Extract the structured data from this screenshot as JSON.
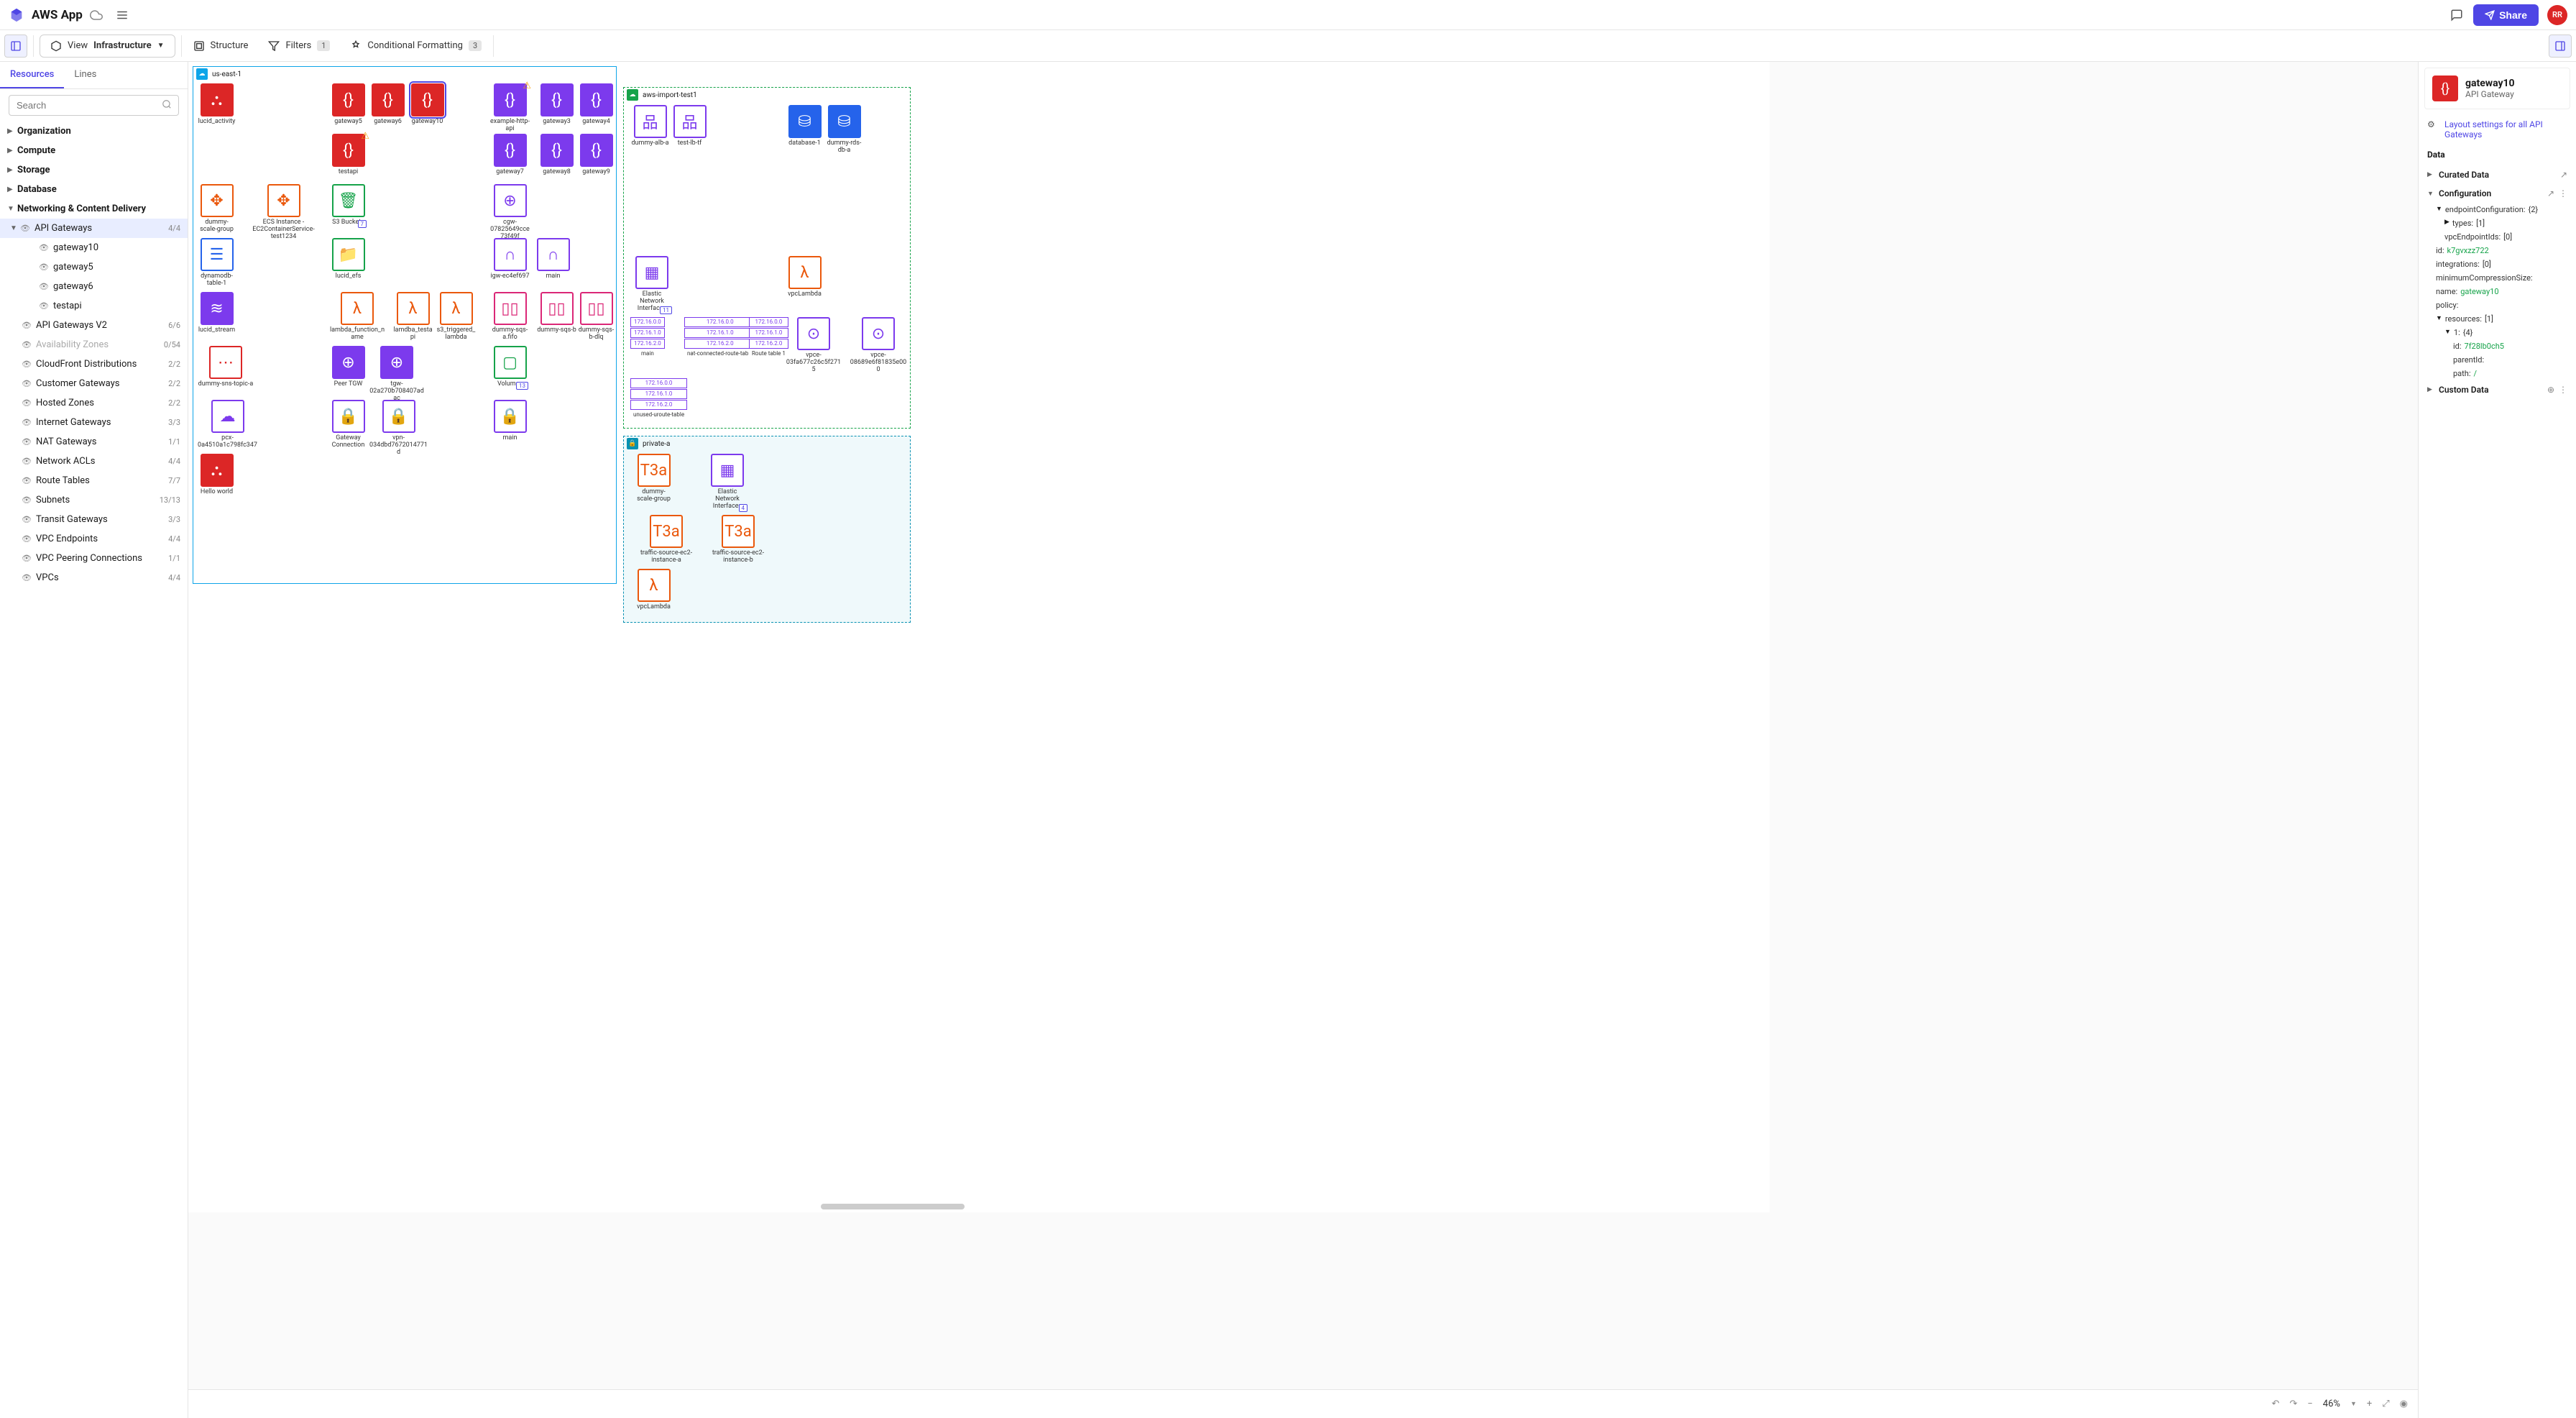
{
  "app": {
    "title": "AWS App",
    "avatar": "RR",
    "share_label": "Share"
  },
  "toolbar": {
    "view_label": "View",
    "view_value": "Infrastructure",
    "structure_label": "Structure",
    "filters_label": "Filters",
    "filters_count": "1",
    "cond_fmt_label": "Conditional Formatting",
    "cond_fmt_count": "3"
  },
  "tabs": {
    "resources": "Resources",
    "lines": "Lines"
  },
  "search": {
    "placeholder": "Search"
  },
  "tree": {
    "organization": "Organization",
    "compute": "Compute",
    "storage": "Storage",
    "database": "Database",
    "networking": "Networking & Content Delivery",
    "api_gateways": {
      "label": "API Gateways",
      "count": "4/4"
    },
    "items_api": [
      "gateway10",
      "gateway5",
      "gateway6",
      "testapi"
    ],
    "rest": [
      {
        "label": "API Gateways V2",
        "count": "6/6"
      },
      {
        "label": "Availability Zones",
        "count": "0/54",
        "dim": true
      },
      {
        "label": "CloudFront Distributions",
        "count": "2/2"
      },
      {
        "label": "Customer Gateways",
        "count": "2/2"
      },
      {
        "label": "Hosted Zones",
        "count": "2/2"
      },
      {
        "label": "Internet Gateways",
        "count": "3/3"
      },
      {
        "label": "NAT Gateways",
        "count": "1/1"
      },
      {
        "label": "Network ACLs",
        "count": "4/4"
      },
      {
        "label": "Route Tables",
        "count": "7/7"
      },
      {
        "label": "Subnets",
        "count": "13/13"
      },
      {
        "label": "Transit Gateways",
        "count": "3/3"
      },
      {
        "label": "VPC Endpoints",
        "count": "4/4"
      },
      {
        "label": "VPC Peering Connections",
        "count": "1/1"
      },
      {
        "label": "VPCs",
        "count": "4/4"
      }
    ]
  },
  "regions": {
    "useast": "us-east-1",
    "awsimport": "aws-import-test1",
    "privatea": "private-a"
  },
  "resources": {
    "lucid_activity": "lucid_activity",
    "gateway5": "gateway5",
    "gateway6": "gateway6",
    "gateway10": "gateway10",
    "testapi": "testapi",
    "example_http": "example-http-api",
    "gateway3": "gateway3",
    "gateway4": "gateway4",
    "gateway7": "gateway7",
    "gateway8": "gateway8",
    "gateway9": "gateway9",
    "dummy_scale": "dummy-scale-group",
    "ecs_instance": "ECS Instance - EC2ContainerService-test1234",
    "s3_buckets": "S3 Buckets",
    "s3_count": "7",
    "dynamodb": "dynamodb-table-1",
    "lucid_efs": "lucid_efs",
    "cgw": "cgw-07825649cce73f49f",
    "igw": "igw-ec4ef697",
    "main": "main",
    "lucid_stream": "lucid_stream",
    "lambda_fn": "lambda_function_name",
    "lambda_test": "lamdba_testapi",
    "s3_trig": "s3_triggered_lambda",
    "sqs_afifo": "dummy-sqs-a.fifo",
    "sqs_b": "dummy-sqs-b",
    "sqs_bdlq": "dummy-sqs-b-dlq",
    "sns_topic": "dummy-sns-topic-a",
    "peer_tgw": "Peer TGW",
    "tgw": "tgw-02a270b708407adac",
    "volumes": "Volumes",
    "vol_count": "13",
    "pcx": "pcx-0a4510a1c798fc347",
    "gw_conn": "Gateway Connection",
    "vpn": "vpn-034dbd7672014771d",
    "main2": "main",
    "hello": "Hello world",
    "dummy_alb": "dummy-alb-a",
    "test_lb": "test-lb-tf",
    "database1": "database-1",
    "dummy_rds": "dummy-rds-db-a",
    "eni": "Elastic Network Interfaces",
    "eni_count": "11",
    "vpclambda": "vpcLambda",
    "rt_main": "main",
    "rt_nat": "nat-connected-route-table",
    "rt_1": "Route table 1",
    "vpce1": "vpce-03fa677c26c5f2715",
    "vpce2": "vpce-08689e6f81835e000",
    "unused_rt": "unused-uroute-table",
    "dummy_scale2": "dummy-scale-group",
    "eni2": "Elastic Network Interfaces",
    "eni2_count": "4",
    "traffic_a": "traffic-source-ec2-instance-a",
    "traffic_b": "traffic-source-ec2-instance-b",
    "t3a": "T3a",
    "vpclambda2": "vpcLambda",
    "ip": "172.16.0.0",
    "ip1": "172.16.1.0",
    "ip2": "172.16.2.0"
  },
  "rpanel": {
    "title": "gateway10",
    "subtitle": "API Gateway",
    "layout_link": "Layout settings for all API Gateways",
    "data_hdr": "Data",
    "curated": "Curated Data",
    "config": "Configuration",
    "endpoint_cfg": "endpointConfiguration:",
    "endpoint_cfg_v": "{2}",
    "types_k": "types:",
    "types_v": "[1]",
    "vpcendpoint_k": "vpcEndpointIds:",
    "vpcendpoint_v": "[0]",
    "id_k": "id:",
    "id_v": "k7gvxzz722",
    "integrations_k": "integrations:",
    "integrations_v": "[0]",
    "mincomp_k": "minimumCompressionSize:",
    "name_k": "name:",
    "name_v": "gateway10",
    "policy_k": "policy:",
    "resources_k": "resources:",
    "resources_v": "[1]",
    "one_k": "1:",
    "one_v": "{4}",
    "rid_k": "id:",
    "rid_v": "7f28lb0ch5",
    "parent_k": "parentId:",
    "path_k": "path:",
    "path_v": "/",
    "custom": "Custom Data"
  },
  "bottom": {
    "zoom": "46%"
  }
}
